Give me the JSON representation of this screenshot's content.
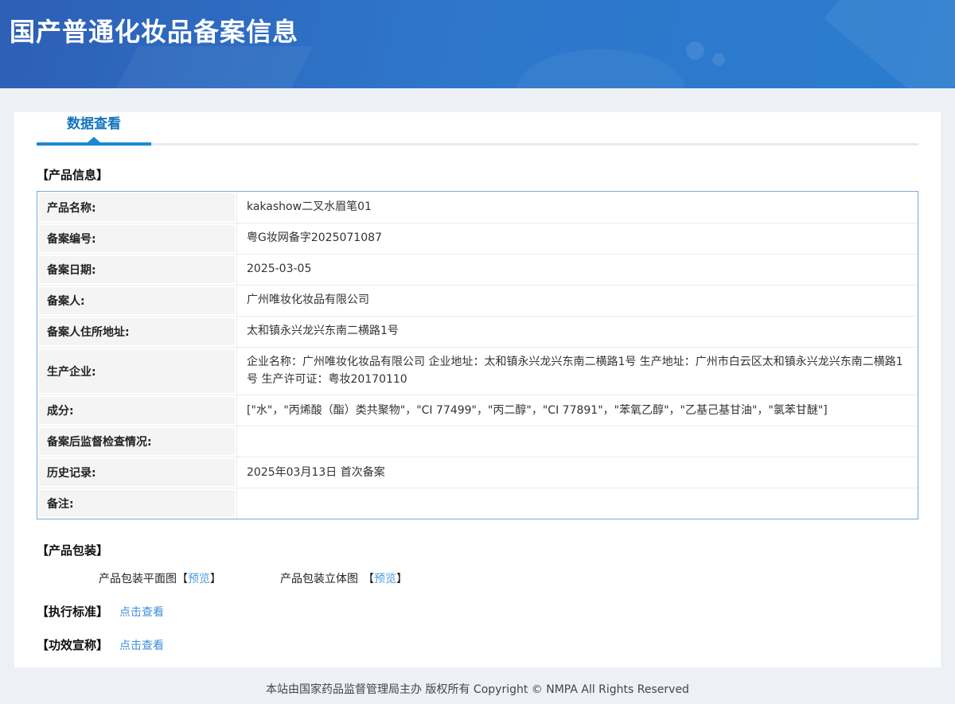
{
  "header": {
    "title": "国产普通化妆品备案信息"
  },
  "tabs": {
    "data_view_label": "数据查看"
  },
  "sections": {
    "product_info_title": "【产品信息】",
    "packaging_title": "【产品包装】",
    "standard_title": "【执行标准】",
    "efficacy_title": "【功效宣称】"
  },
  "product_info": {
    "rows": [
      {
        "label": "产品名称:",
        "value": "kakashow二叉水眉笔01"
      },
      {
        "label": "备案编号:",
        "value": "粤G妆网备字2025071087"
      },
      {
        "label": "备案日期:",
        "value": "2025-03-05"
      },
      {
        "label": "备案人:",
        "value": "广州唯妆化妆品有限公司"
      },
      {
        "label": "备案人住所地址:",
        "value": "太和镇永兴龙兴东南二横路1号"
      },
      {
        "label": "生产企业:",
        "value": "企业名称：广州唯妆化妆品有限公司 企业地址：太和镇永兴龙兴东南二横路1号 生产地址：广州市白云区太和镇永兴龙兴东南二横路1号 生产许可证：粤妆20170110"
      },
      {
        "label": "成分:",
        "value": "[\"水\"，\"丙烯酸（酯）类共聚物\"，\"CI 77499\"，\"丙二醇\"，\"CI 77891\"，\"苯氧乙醇\"，\"乙基己基甘油\"，\"氯苯甘醚\"]"
      },
      {
        "label": "备案后监督检查情况:",
        "value": ""
      },
      {
        "label": "历史记录:",
        "value": "2025年03月13日 首次备案"
      },
      {
        "label": "备注:",
        "value": ""
      }
    ]
  },
  "packaging": {
    "bracket_open": "【",
    "bracket_close": "】",
    "items": [
      {
        "label": "产品包装平面图",
        "link": "预览"
      },
      {
        "label": "产品包装立体图",
        "link": "预览"
      }
    ]
  },
  "links": {
    "view_label": "点击查看"
  },
  "footer": {
    "text": "本站由国家药品监督管理局主办 版权所有 Copyright © NMPA All Rights Reserved"
  },
  "colors": {
    "header_gradient_start": "#2d5fb5",
    "header_gradient_end": "#2a7ccf",
    "tab_accent": "#1e86d2",
    "tab_text": "#1574bd",
    "table_border": "#78a8d8",
    "label_cell_bg": "#f4f4f4",
    "link_blue": "#4c9be0"
  }
}
